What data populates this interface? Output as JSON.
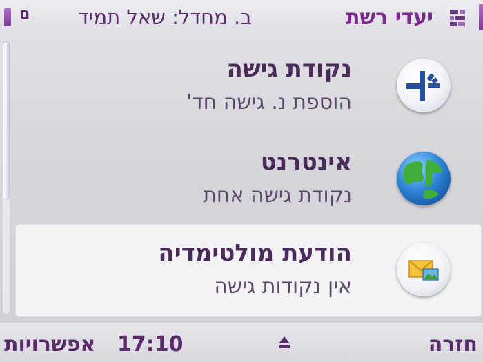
{
  "title_bar": {
    "app_title": "יעדי רשת",
    "info_text": "ב. מחדל: שאל תמיד",
    "status_mark": "ם"
  },
  "list": {
    "items": [
      {
        "title": "נקודת גישה",
        "subtitle": "הוספת נ. גישה חד'",
        "icon": "access-point-icon",
        "selected": false
      },
      {
        "title": "אינטרנט",
        "subtitle": "נקודת גישה אחת",
        "icon": "globe-icon",
        "selected": false
      },
      {
        "title": "הודעת מולטימדיה",
        "subtitle": "אין נקודות גישה",
        "icon": "mms-envelope-icon",
        "selected": true
      }
    ]
  },
  "softkeys": {
    "left": "אפשרויות",
    "right": "חזרה",
    "clock": "17:10"
  },
  "colors": {
    "accent": "#7a2a8c",
    "text": "#4a2a58"
  }
}
